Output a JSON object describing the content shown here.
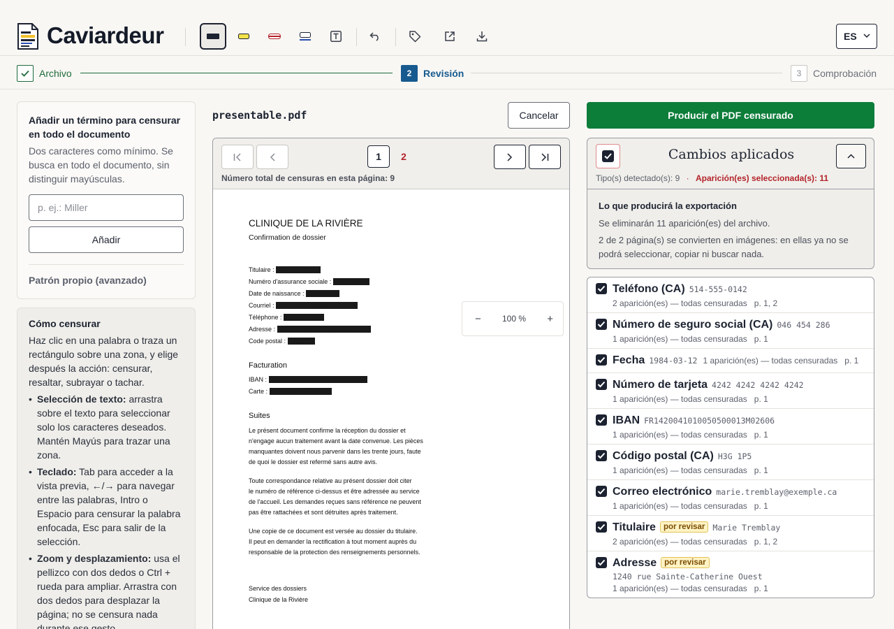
{
  "app": {
    "title": "Caviardeur"
  },
  "toolbar": {
    "tools": [
      {
        "name": "redact-tool",
        "active": true
      },
      {
        "name": "highlight-tool"
      },
      {
        "name": "strikethrough-tool"
      },
      {
        "name": "underline-tool"
      },
      {
        "name": "text-tool"
      },
      {
        "name": "undo"
      },
      {
        "name": "tag"
      },
      {
        "name": "open-external"
      },
      {
        "name": "download"
      }
    ],
    "language": "ES"
  },
  "stepper": {
    "steps": [
      {
        "num": "✓",
        "label": "Archivo",
        "state": "done"
      },
      {
        "num": "2",
        "label": "Revisión",
        "state": "current"
      },
      {
        "num": "3",
        "label": "Comprobación",
        "state": "pending"
      }
    ]
  },
  "sidebar": {
    "add_term": {
      "title": "Añadir un término para censurar en todo el documento",
      "hint": "Dos caracteres como mínimo. Se busca en todo el documento, sin distinguir mayúsculas.",
      "placeholder": "p. ej.: Miller",
      "button": "Añadir",
      "custom_pattern": "Patrón propio (avanzado)"
    },
    "help": {
      "title": "Cómo censurar",
      "intro": "Haz clic en una palabra o traza un rectángulo sobre una zona, y elige después la acción: censurar, resaltar, subrayar o tachar.",
      "items": [
        {
          "bold": "Selección de texto:",
          "text": " arrastra sobre el texto para seleccionar solo los caracteres deseados. Mantén Mayús para trazar una zona."
        },
        {
          "bold": "Teclado:",
          "text": " Tab para acceder a la vista previa, ←/→ para navegar entre las palabras, Intro o Espacio para censurar la palabra enfocada, Esc para salir de la selección."
        },
        {
          "bold": "Zoom y desplazamiento:",
          "text": " usa el pellizco con dos dedos o Ctrl + rueda para ampliar. Arrastra con dos dedos para desplazar la página; no se censura nada durante ese gesto."
        }
      ]
    }
  },
  "viewer": {
    "filename": "presentable.pdf",
    "cancel": "Cancelar",
    "pages": [
      "1",
      "2"
    ],
    "current_page": "1",
    "total_label": "Número total de censuras en esta página: 9",
    "zoom": {
      "minus": "−",
      "value": "100 %",
      "plus": "+"
    },
    "document": {
      "title": "CLINIQUE DE LA RIVIÈRE",
      "subtitle": "Confirmation de dossier",
      "fields": [
        {
          "label": "Titulaire : ",
          "value": "Marie Tremblay"
        },
        {
          "label": "Numéro d'assurance sociale : ",
          "value": "046 454 286"
        },
        {
          "label": "Date de naissance : ",
          "value": "1984-03-12"
        },
        {
          "label": "Courriel : ",
          "value": "marie.tremblay@exemple.ca"
        },
        {
          "label": "Téléphone : ",
          "value": "514-555-0142"
        },
        {
          "label": "Adresse : ",
          "value": "1240 rue Sainte-Catherine Ouest"
        },
        {
          "label": "Code postal : ",
          "value": "H3G 1P5"
        }
      ],
      "billing_heading": "Facturation",
      "billing": [
        {
          "label": "IBAN : ",
          "value": "FR1420041010050500013M02606"
        },
        {
          "label": "Carte : ",
          "value": "4242 4242 4242 4242"
        }
      ],
      "suites_heading": "Suites",
      "paragraphs": [
        [
          "Le présent document confirme la réception du dossier et",
          "n'engage aucun traitement avant la date convenue. Les pièces",
          "manquantes doivent nous parvenir dans les trente jours, faute",
          "de quoi le dossier est refermé sans autre avis."
        ],
        [
          "Toute correspondance relative au présent dossier doit citer",
          "le numéro de référence ci-dessus et être adressée au service",
          "de l'accueil. Les demandes reçues sans référence ne peuvent",
          "pas être rattachées et sont détruites après traitement."
        ],
        [
          "Une copie de ce document est versée au dossier du titulaire.",
          "Il peut en demander la rectification à tout moment auprès du",
          "responsable de la protection des renseignements personnels."
        ]
      ],
      "signature": [
        "Service des dossiers",
        "Clinique de la Rivière"
      ]
    }
  },
  "right_panel": {
    "produce_button": "Producir el PDF censurado",
    "changes_title": "Cambios aplicados",
    "types_detected": "Tipo(s) detectado(s): 9",
    "separator": "·",
    "selected": "Aparición(es) seleccionada(s): 11",
    "export": {
      "title": "Lo que producirá la exportación",
      "line1": "Se eliminarán 11 aparición(es) del archivo.",
      "line2": "2 de 2 página(s) se convierten en imágenes: en ellas ya no se podrá seleccionar, copiar ni buscar nada."
    },
    "items": [
      {
        "name": "Teléfono (CA)",
        "value": "514-555-0142",
        "meta": "2 aparición(es) — todas censuradas   p. 1, 2",
        "badge": ""
      },
      {
        "name": "Número de seguro social (CA)",
        "value": "046 454 286",
        "meta": "1 aparición(es) — todas censuradas   p. 1",
        "badge": ""
      },
      {
        "name": "Fecha",
        "value": "1984-03-12",
        "meta": "1 aparición(es) — todas censuradas   p. 1",
        "badge": "",
        "inline": true
      },
      {
        "name": "Número de tarjeta",
        "value": "4242 4242 4242 4242",
        "meta": "1 aparición(es) — todas censuradas   p. 1",
        "badge": ""
      },
      {
        "name": "IBAN",
        "value": "FR1420041010050500013M02606",
        "meta": "1 aparición(es) — todas censuradas   p. 1",
        "badge": ""
      },
      {
        "name": "Código postal (CA)",
        "value": "H3G 1P5",
        "meta": "1 aparición(es) — todas censuradas   p. 1",
        "badge": ""
      },
      {
        "name": "Correo electrónico",
        "value": "marie.tremblay@exemple.ca",
        "meta": "1 aparición(es) — todas censuradas   p. 1",
        "badge": ""
      },
      {
        "name": "Titulaire",
        "value": "Marie Tremblay",
        "meta": "2 aparición(es) — todas censuradas   p. 1, 2",
        "badge": "por revisar"
      },
      {
        "name": "Adresse",
        "value": "1240 rue Sainte-Catherine Ouest",
        "meta": "1 aparición(es) — todas censuradas   p. 1",
        "badge": "por revisar",
        "value_below": true
      }
    ]
  }
}
